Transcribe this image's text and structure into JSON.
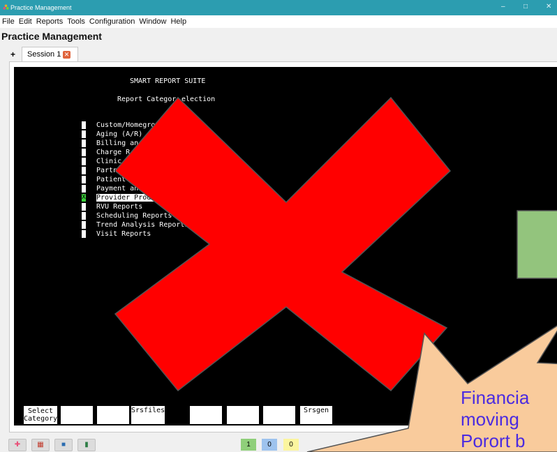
{
  "window": {
    "title": "Practice Management",
    "app_title": "Practice Management"
  },
  "menu": [
    "File",
    "Edit",
    "Reports",
    "Tools",
    "Configuration",
    "Window",
    "Help"
  ],
  "tabs": {
    "add_label": "+",
    "session_label": "Session 1"
  },
  "terminal": {
    "header": "SMART REPORT SUITE",
    "subheader_left": "Report Categor",
    "subheader_right": "election",
    "items": [
      "Custom/Homegro",
      "Aging (A/R) ",
      "Billing an",
      "Charge R",
      "Clinic",
      "Partn",
      "Patient",
      "Payment and",
      "Provider Produ",
      "RVU Reports",
      "Scheduling Reports",
      "Trend Analysis Reports",
      "Visit Reports"
    ],
    "selected_marker": "X",
    "function_keys": [
      "Select\nCategory",
      "",
      "",
      "Srsfiles",
      "",
      "",
      "",
      "Srsgen"
    ]
  },
  "status": {
    "badge_green": "1",
    "badge_blue": "0",
    "badge_yellow": "0"
  },
  "annotation": {
    "callout_lines": [
      "Financia",
      "moving",
      "Porort b"
    ]
  },
  "colors": {
    "titlebar": "#2c9db0",
    "terminal_bg": "#000000",
    "x_mark": "#ff0000",
    "green_box": "#93c47d",
    "callout_fill": "#f9cb9c",
    "callout_text": "#4b2be0"
  }
}
